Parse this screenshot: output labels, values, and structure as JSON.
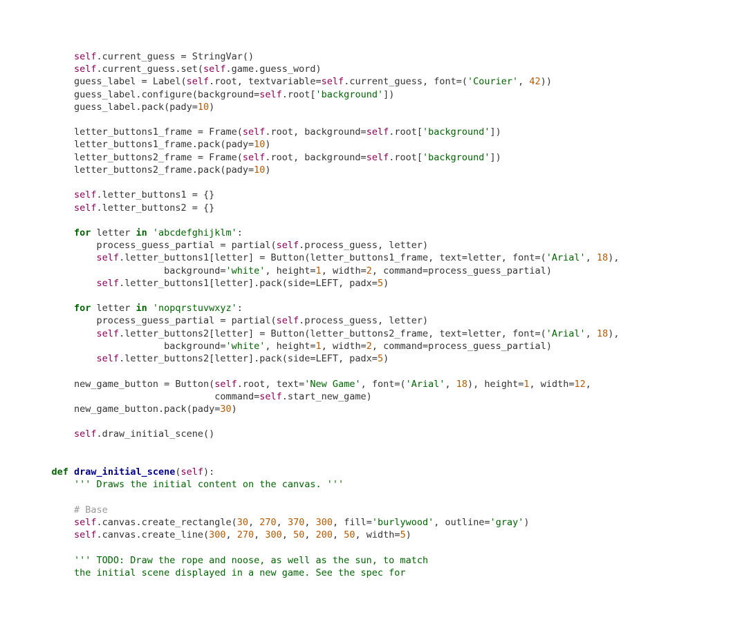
{
  "code": {
    "lines": [
      {
        "indent": 0,
        "html": "<span class='kw-self'>self</span><span class='plain'>.current_guess = StringVar()</span>"
      },
      {
        "indent": 0,
        "html": "<span class='kw-self'>self</span><span class='plain'>.current_guess.set(</span><span class='kw-self'>self</span><span class='plain'>.game.guess_word)</span>"
      },
      {
        "indent": 0,
        "html": "<span class='plain'>guess_label = Label(</span><span class='kw-self'>self</span><span class='plain'>.root, textvariable=</span><span class='kw-self'>self</span><span class='plain'>.current_guess, font=(</span><span class='str'>'Courier'</span><span class='plain'>, </span><span class='num'>42</span><span class='plain'>))</span>"
      },
      {
        "indent": 0,
        "html": "<span class='plain'>guess_label.configure(background=</span><span class='kw-self'>self</span><span class='plain'>.root[</span><span class='str'>'background'</span><span class='plain'>])</span>"
      },
      {
        "indent": 0,
        "html": "<span class='plain'>guess_label.pack(pady=</span><span class='num'>10</span><span class='plain'>)</span>"
      },
      {
        "indent": 0,
        "html": ""
      },
      {
        "indent": 0,
        "html": "<span class='plain'>letter_buttons1_frame = Frame(</span><span class='kw-self'>self</span><span class='plain'>.root, background=</span><span class='kw-self'>self</span><span class='plain'>.root[</span><span class='str'>'background'</span><span class='plain'>])</span>"
      },
      {
        "indent": 0,
        "html": "<span class='plain'>letter_buttons1_frame.pack(pady=</span><span class='num'>10</span><span class='plain'>)</span>"
      },
      {
        "indent": 0,
        "html": "<span class='plain'>letter_buttons2_frame = Frame(</span><span class='kw-self'>self</span><span class='plain'>.root, background=</span><span class='kw-self'>self</span><span class='plain'>.root[</span><span class='str'>'background'</span><span class='plain'>])</span>"
      },
      {
        "indent": 0,
        "html": "<span class='plain'>letter_buttons2_frame.pack(pady=</span><span class='num'>10</span><span class='plain'>)</span>"
      },
      {
        "indent": 0,
        "html": ""
      },
      {
        "indent": 0,
        "html": "<span class='kw-self'>self</span><span class='plain'>.letter_buttons1 = {}</span>"
      },
      {
        "indent": 0,
        "html": "<span class='kw-self'>self</span><span class='plain'>.letter_buttons2 = {}</span>"
      },
      {
        "indent": 0,
        "html": ""
      },
      {
        "indent": 0,
        "html": "<span class='kw'>for</span><span class='plain'> letter </span><span class='kw'>in</span><span class='plain'> </span><span class='str'>'abcdefghijklm'</span><span class='plain'>:</span>"
      },
      {
        "indent": 1,
        "html": "<span class='plain'>process_guess_partial = partial(</span><span class='kw-self'>self</span><span class='plain'>.process_guess, letter)</span>"
      },
      {
        "indent": 1,
        "html": "<span class='kw-self'>self</span><span class='plain'>.letter_buttons1[letter] = Button(letter_buttons1_frame, text=letter, font=(</span><span class='str'>'Arial'</span><span class='plain'>, </span><span class='num'>18</span><span class='plain'>),</span>"
      },
      {
        "indent": 1,
        "html": "<span class='plain'>            background=</span><span class='str'>'white'</span><span class='plain'>, height=</span><span class='num'>1</span><span class='plain'>, width=</span><span class='num'>2</span><span class='plain'>, command=process_guess_partial)</span>"
      },
      {
        "indent": 1,
        "html": "<span class='kw-self'>self</span><span class='plain'>.letter_buttons1[letter].pack(side=LEFT, padx=</span><span class='num'>5</span><span class='plain'>)</span>"
      },
      {
        "indent": 0,
        "html": ""
      },
      {
        "indent": 0,
        "html": "<span class='kw'>for</span><span class='plain'> letter </span><span class='kw'>in</span><span class='plain'> </span><span class='str'>'nopqrstuvwxyz'</span><span class='plain'>:</span>"
      },
      {
        "indent": 1,
        "html": "<span class='plain'>process_guess_partial = partial(</span><span class='kw-self'>self</span><span class='plain'>.process_guess, letter)</span>"
      },
      {
        "indent": 1,
        "html": "<span class='kw-self'>self</span><span class='plain'>.letter_buttons2[letter] = Button(letter_buttons2_frame, text=letter, font=(</span><span class='str'>'Arial'</span><span class='plain'>, </span><span class='num'>18</span><span class='plain'>),</span>"
      },
      {
        "indent": 1,
        "html": "<span class='plain'>            background=</span><span class='str'>'white'</span><span class='plain'>, height=</span><span class='num'>1</span><span class='plain'>, width=</span><span class='num'>2</span><span class='plain'>, command=process_guess_partial)</span>"
      },
      {
        "indent": 1,
        "html": "<span class='kw-self'>self</span><span class='plain'>.letter_buttons2[letter].pack(side=LEFT, padx=</span><span class='num'>5</span><span class='plain'>)</span>"
      },
      {
        "indent": 0,
        "html": ""
      },
      {
        "indent": 0,
        "html": "<span class='plain'>new_game_button = Button(</span><span class='kw-self'>self</span><span class='plain'>.root, text=</span><span class='str'>'New Game'</span><span class='plain'>, font=(</span><span class='str'>'Arial'</span><span class='plain'>, </span><span class='num'>18</span><span class='plain'>), height=</span><span class='num'>1</span><span class='plain'>, width=</span><span class='num'>12</span><span class='plain'>,</span>"
      },
      {
        "indent": 0,
        "html": "<span class='plain'>                         command=</span><span class='kw-self'>self</span><span class='plain'>.start_new_game)</span>"
      },
      {
        "indent": 0,
        "html": "<span class='plain'>new_game_button.pack(pady=</span><span class='num'>30</span><span class='plain'>)</span>"
      },
      {
        "indent": 0,
        "html": ""
      },
      {
        "indent": 0,
        "html": "<span class='kw-self'>self</span><span class='plain'>.draw_initial_scene()</span>"
      },
      {
        "indent": 0,
        "html": ""
      },
      {
        "indent": 0,
        "html": ""
      },
      {
        "indent": -1,
        "html": "<span class='kw'>def</span><span class='plain'> </span><span class='def-name'>draw_initial_scene</span><span class='plain'>(</span><span class='kw-self'>self</span><span class='plain'>):</span>"
      },
      {
        "indent": 0,
        "html": "<span class='docstr'>''' Draws the initial content on the canvas. '''</span>"
      },
      {
        "indent": 0,
        "html": ""
      },
      {
        "indent": 0,
        "html": "<span class='comment'># Base</span>"
      },
      {
        "indent": 0,
        "html": "<span class='kw-self'>self</span><span class='plain'>.canvas.create_rectangle(</span><span class='num'>30</span><span class='plain'>, </span><span class='num'>270</span><span class='plain'>, </span><span class='num'>370</span><span class='plain'>, </span><span class='num'>300</span><span class='plain'>, fill=</span><span class='str'>'burlywood'</span><span class='plain'>, outline=</span><span class='str'>'gray'</span><span class='plain'>)</span>"
      },
      {
        "indent": 0,
        "html": "<span class='kw-self'>self</span><span class='plain'>.canvas.create_line(</span><span class='num'>300</span><span class='plain'>, </span><span class='num'>270</span><span class='plain'>, </span><span class='num'>300</span><span class='plain'>, </span><span class='num'>50</span><span class='plain'>, </span><span class='num'>200</span><span class='plain'>, </span><span class='num'>50</span><span class='plain'>, width=</span><span class='num'>5</span><span class='plain'>)</span>"
      },
      {
        "indent": 0,
        "html": ""
      },
      {
        "indent": 0,
        "html": "<span class='docstr'>''' TODO: Draw the rope and noose, as well as the sun, to match</span>"
      },
      {
        "indent": 0,
        "html": "<span class='docstr'>the initial scene displayed in a new game. See the spec for</span>"
      }
    ],
    "base_indent": "        ",
    "indent_unit": "    "
  }
}
